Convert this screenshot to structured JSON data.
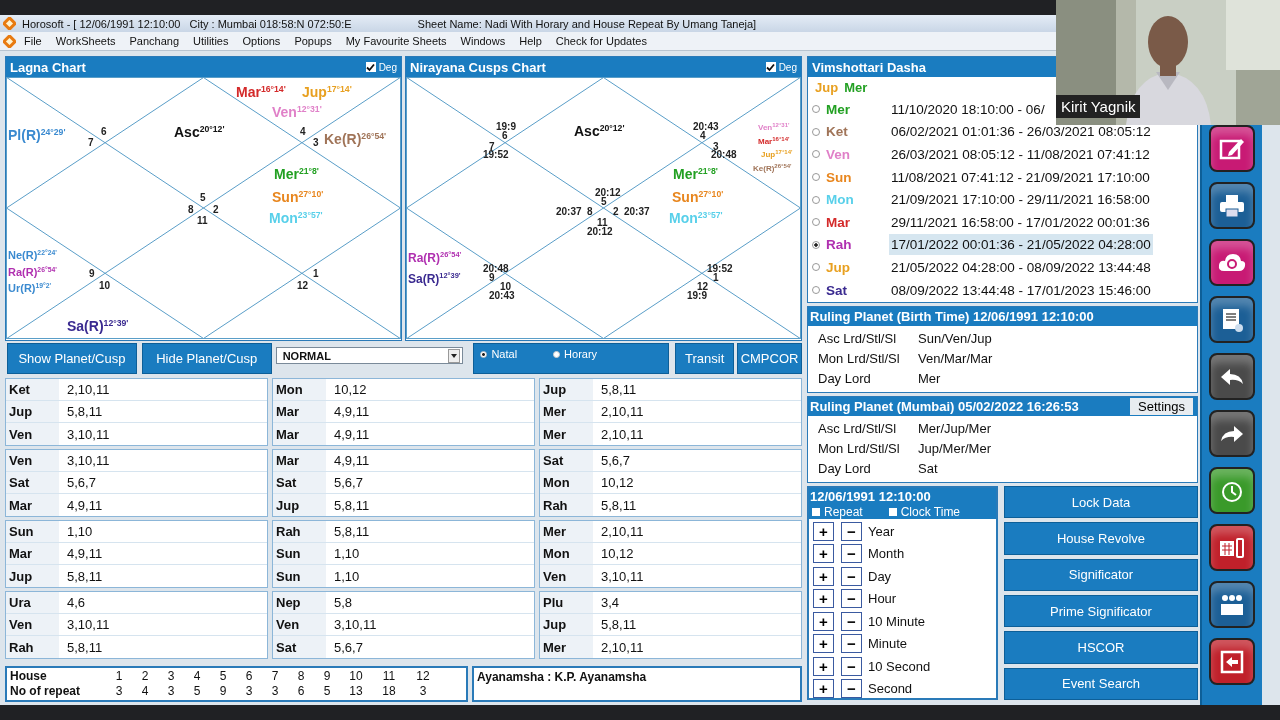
{
  "window": {
    "title": "Horosoft - [ 12/06/1991 12:10:00   City : Mumbai 018:58:N 072:50:E",
    "sheet_name": "Sheet Name: Nadi With Horary and House Repeat By Umang Taneja]"
  },
  "menu": [
    "File",
    "WorkSheets",
    "Panchang",
    "Utilities",
    "Options",
    "Popups",
    "My Favourite Sheets",
    "Windows",
    "Help",
    "Check for Updates"
  ],
  "lagna_chart": {
    "title": "Lagna Chart",
    "deg_label": "Deg",
    "deg_checked": true,
    "planets": [
      {
        "name": "Mar",
        "deg": "16°14'",
        "color": "#d42a2a"
      },
      {
        "name": "Jup",
        "deg": "17°14'",
        "color": "#e8a020"
      },
      {
        "name": "Ven",
        "deg": "12°31'",
        "color": "#e080c8"
      },
      {
        "name": "Pl(R)",
        "deg": "24°29'",
        "color": "#3a8ad0"
      },
      {
        "name": "Asc",
        "deg": "20°12'",
        "color": "#111111"
      },
      {
        "name": "Ke(R)",
        "deg": "26°54'",
        "color": "#a07458"
      },
      {
        "name": "Mer",
        "deg": "21°8'",
        "color": "#22a022"
      },
      {
        "name": "Sun",
        "deg": "27°10'",
        "color": "#e8861e"
      },
      {
        "name": "Mon",
        "deg": "23°57'",
        "color": "#58d0ea"
      },
      {
        "name": "Ne(R)",
        "deg": "22°24'",
        "color": "#3a8ad0"
      },
      {
        "name": "Ra(R)",
        "deg": "26°54'",
        "color": "#b030b0"
      },
      {
        "name": "Ur(R)",
        "deg": "19°2'",
        "color": "#3a8ad0"
      },
      {
        "name": "Sa(R)",
        "deg": "12°39'",
        "color": "#3a2a90"
      }
    ],
    "labels": [
      "6",
      "7",
      "4",
      "3",
      "5",
      "8",
      "2",
      "11",
      "9",
      "10",
      "1",
      "12"
    ]
  },
  "cusps_chart": {
    "title": "Nirayana Cusps Chart",
    "deg_label": "Deg",
    "deg_checked": true,
    "planets": [
      {
        "name": "Asc",
        "deg": "20°12'",
        "color": "#111111"
      },
      {
        "name": "Ven",
        "deg": "12°31'",
        "color": "#e080c8"
      },
      {
        "name": "Mar",
        "deg": "16°14'",
        "color": "#d42a2a"
      },
      {
        "name": "Jup",
        "deg": "17°14'",
        "color": "#e8a020"
      },
      {
        "name": "Ke(R)",
        "deg": "26°54'",
        "color": "#a07458"
      },
      {
        "name": "Mer",
        "deg": "21°8'",
        "color": "#22a022"
      },
      {
        "name": "Sun",
        "deg": "27°10'",
        "color": "#e8861e"
      },
      {
        "name": "Mon",
        "deg": "23°57'",
        "color": "#58d0ea"
      },
      {
        "name": "Ra(R)",
        "deg": "26°54'",
        "color": "#b030b0"
      },
      {
        "name": "Sa(R)",
        "deg": "12°39'",
        "color": "#3a2a90"
      }
    ],
    "labels": [
      "19:9",
      "6",
      "7",
      "19:52",
      "20:43",
      "4",
      "3",
      "20:48",
      "20:12",
      "5",
      "20:37",
      "8",
      "2",
      "20:37",
      "11",
      "20:12",
      "20:48",
      "9",
      "10",
      "20:43",
      "19:52",
      "1",
      "12",
      "19:9"
    ]
  },
  "controls": {
    "show_button": "Show Planet/Cusp",
    "hide_button": "Hide Planet/Cusp",
    "mode_value": "NORMAL",
    "chart_modes": [
      {
        "label": "Natal",
        "selected": true
      },
      {
        "label": "Horary",
        "selected": false
      }
    ],
    "transit_button": "Transit",
    "cmpcor_button": "CMPCOR"
  },
  "significator_tables": [
    [
      [
        [
          "Ket",
          "2,10,11"
        ],
        [
          "Jup",
          "5,8,11"
        ],
        [
          "Ven",
          "3,10,11"
        ]
      ],
      [
        [
          "Ven",
          "3,10,11"
        ],
        [
          "Sat",
          "5,6,7"
        ],
        [
          "Mar",
          "4,9,11"
        ]
      ],
      [
        [
          "Sun",
          "1,10"
        ],
        [
          "Mar",
          "4,9,11"
        ],
        [
          "Jup",
          "5,8,11"
        ]
      ],
      [
        [
          "Ura",
          "4,6"
        ],
        [
          "Ven",
          "3,10,11"
        ],
        [
          "Rah",
          "5,8,11"
        ]
      ]
    ],
    [
      [
        [
          "Mon",
          "10,12"
        ],
        [
          "Mar",
          "4,9,11"
        ],
        [
          "Mar",
          "4,9,11"
        ]
      ],
      [
        [
          "Mar",
          "4,9,11"
        ],
        [
          "Sat",
          "5,6,7"
        ],
        [
          "Jup",
          "5,8,11"
        ]
      ],
      [
        [
          "Rah",
          "5,8,11"
        ],
        [
          "Sun",
          "1,10"
        ],
        [
          "Sun",
          "1,10"
        ]
      ],
      [
        [
          "Nep",
          "5,8"
        ],
        [
          "Ven",
          "3,10,11"
        ],
        [
          "Sat",
          "5,6,7"
        ]
      ]
    ],
    [
      [
        [
          "Jup",
          "5,8,11"
        ],
        [
          "Mer",
          "2,10,11"
        ],
        [
          "Mer",
          "2,10,11"
        ]
      ],
      [
        [
          "Sat",
          "5,6,7"
        ],
        [
          "Mon",
          "10,12"
        ],
        [
          "Rah",
          "5,8,11"
        ]
      ],
      [
        [
          "Mer",
          "2,10,11"
        ],
        [
          "Mon",
          "10,12"
        ],
        [
          "Ven",
          "3,10,11"
        ]
      ],
      [
        [
          "Plu",
          "3,4"
        ],
        [
          "Jup",
          "5,8,11"
        ],
        [
          "Mer",
          "2,10,11"
        ]
      ]
    ]
  ],
  "house_repeat": {
    "house_label": "House",
    "repeat_label": "No of repeat",
    "houses": [
      "1",
      "2",
      "3",
      "4",
      "5",
      "6",
      "7",
      "8",
      "9",
      "10",
      "11",
      "12"
    ],
    "repeats": [
      "3",
      "4",
      "3",
      "5",
      "9",
      "3",
      "3",
      "6",
      "5",
      "13",
      "18",
      "3"
    ]
  },
  "ayanamsha": "Ayanamsha : K.P. Ayanamsha",
  "dasha": {
    "title": "Vimshottari Dasha",
    "current": [
      {
        "name": "Jup",
        "color": "#e8a020"
      },
      {
        "name": "Mer",
        "color": "#22a022"
      }
    ],
    "rows": [
      {
        "planet": "Mer",
        "color": "#22a022",
        "period": "11/10/2020 18:10:00 - 06/",
        "selected": false
      },
      {
        "planet": "Ket",
        "color": "#a07458",
        "period": "06/02/2021 01:01:36 - 26/03/2021 08:05:12",
        "selected": false
      },
      {
        "planet": "Ven",
        "color": "#e080c8",
        "period": "26/03/2021 08:05:12 - 11/08/2021 07:41:12",
        "selected": false
      },
      {
        "planet": "Sun",
        "color": "#e8861e",
        "period": "11/08/2021 07:41:12 - 21/09/2021 17:10:00",
        "selected": false
      },
      {
        "planet": "Mon",
        "color": "#58d0ea",
        "period": "21/09/2021 17:10:00 - 29/11/2021 16:58:00",
        "selected": false
      },
      {
        "planet": "Mar",
        "color": "#d42a2a",
        "period": "29/11/2021 16:58:00 - 17/01/2022 00:01:36",
        "selected": false
      },
      {
        "planet": "Rah",
        "color": "#b030b0",
        "period": "17/01/2022 00:01:36 - 21/05/2022 04:28:00",
        "selected": true
      },
      {
        "planet": "Jup",
        "color": "#e8a020",
        "period": "21/05/2022 04:28:00 - 08/09/2022 13:44:48",
        "selected": false
      },
      {
        "planet": "Sat",
        "color": "#3a2a90",
        "period": "08/09/2022 13:44:48 - 17/01/2023 15:46:00",
        "selected": false
      }
    ]
  },
  "ruling_birth": {
    "title": "Ruling Planet (Birth Time) 12/06/1991 12:10:00",
    "rows": [
      [
        "Asc Lrd/Stl/Sl",
        "Sun/Ven/Jup"
      ],
      [
        "Mon Lrd/Stl/Sl",
        "Ven/Mar/Mar"
      ],
      [
        "Day Lord",
        "Mer"
      ]
    ]
  },
  "ruling_now": {
    "title": "Ruling Planet (Mumbai) 05/02/2022 16:26:53",
    "settings_button": "Settings",
    "rows": [
      [
        "Asc Lrd/Stl/Sl",
        "Mer/Jup/Mer"
      ],
      [
        "Mon Lrd/Stl/Sl",
        "Jup/Mer/Mer"
      ],
      [
        "Day Lord",
        "Sat"
      ]
    ]
  },
  "time_panel": {
    "datetime": "12/06/1991 12:10:00",
    "options": [
      {
        "label": "Repeat",
        "checked": false
      },
      {
        "label": "Clock Time",
        "checked": false
      }
    ],
    "plus": "+",
    "minus": "−",
    "steps": [
      "Year",
      "Month",
      "Day",
      "Hour",
      "10 Minute",
      "Minute",
      "10 Second",
      "Second"
    ]
  },
  "action_buttons": [
    "Lock Data",
    "House Revolve",
    "Significator",
    "Prime Significator",
    "HSCOR",
    "Event Search"
  ],
  "toolbar": [
    {
      "kind": "edit"
    },
    {
      "kind": "print"
    },
    {
      "kind": "sync"
    },
    {
      "kind": "document"
    },
    {
      "kind": "back"
    },
    {
      "kind": "forward"
    },
    {
      "kind": "alarm"
    },
    {
      "kind": "calendar"
    },
    {
      "kind": "people"
    },
    {
      "kind": "exit"
    }
  ],
  "video_tile": {
    "kind": "picture",
    "name": "Kirit Yagnik"
  }
}
